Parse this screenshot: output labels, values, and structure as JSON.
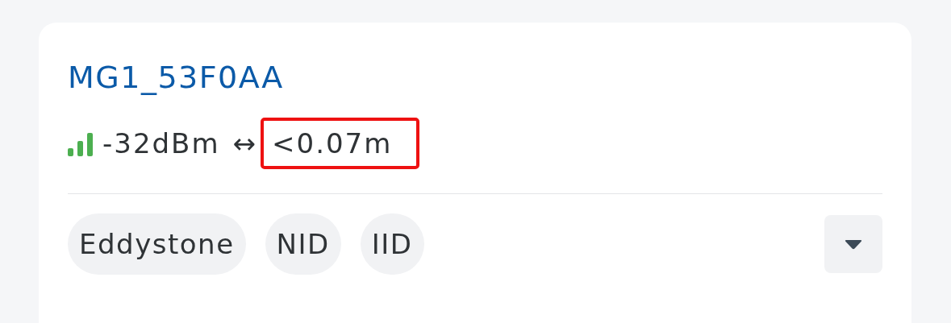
{
  "device": {
    "name": "MG1_53F0AA",
    "rssi": "-32dBm",
    "range_symbol": "↔",
    "distance": {
      "text": "<0.07m",
      "highlighted": true
    },
    "tags": [
      {
        "label": "Eddystone"
      },
      {
        "label": "NID"
      },
      {
        "label": "IID"
      }
    ],
    "expand_button": {
      "expanded": false
    }
  }
}
